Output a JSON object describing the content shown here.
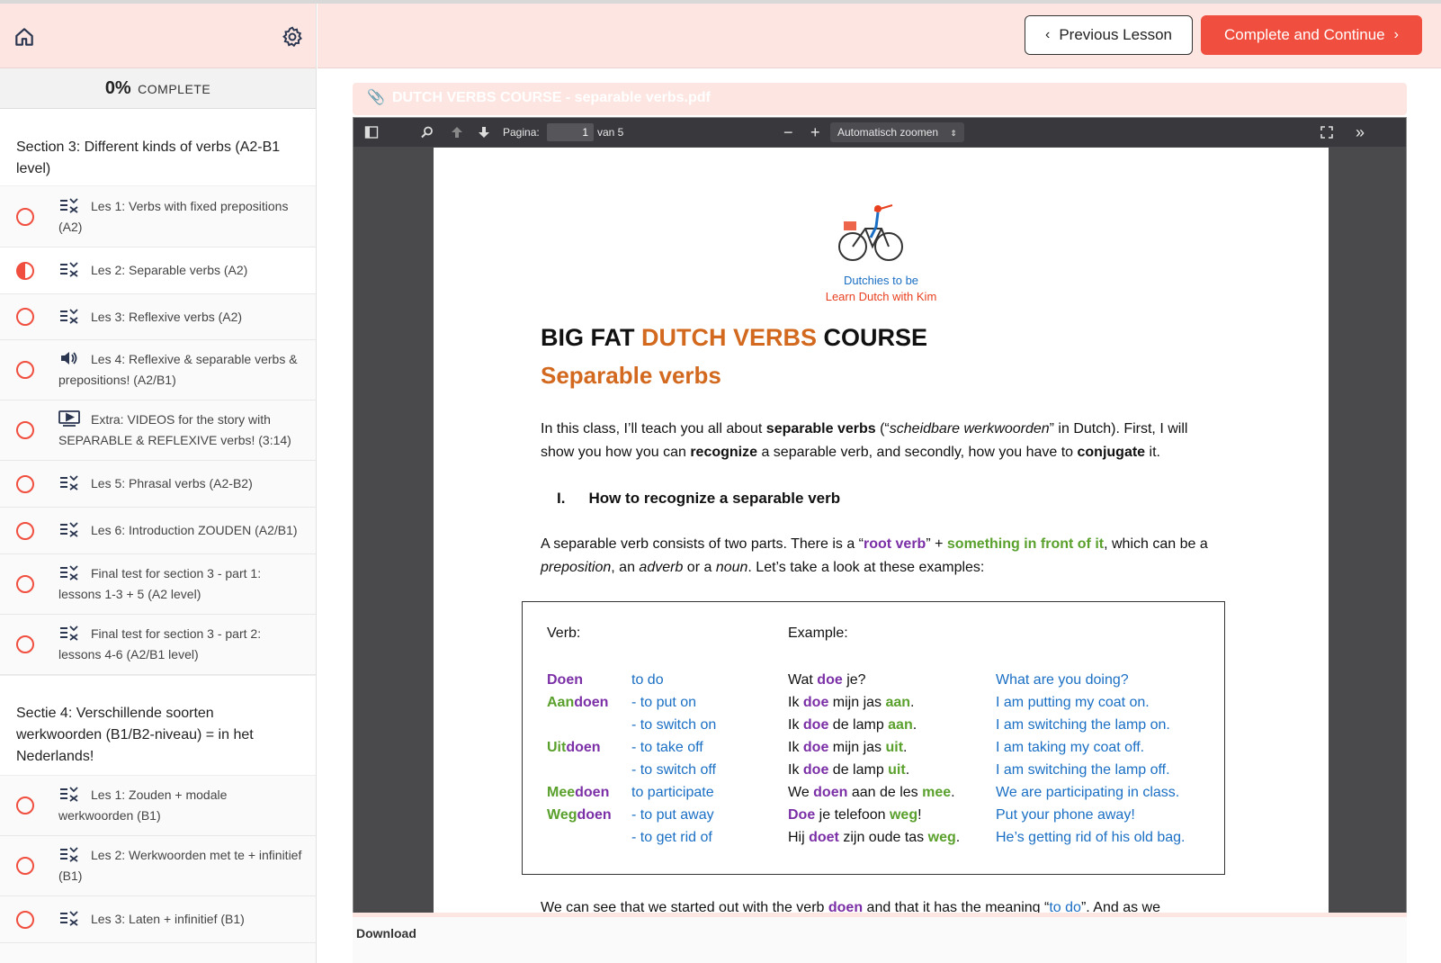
{
  "sidebar": {
    "progress": {
      "percent": "0%",
      "label": "COMPLETE"
    },
    "section3": {
      "title": "Section 3: Different kinds of verbs (A2-B1 level)",
      "lessons": [
        {
          "icon": "quiz-icon",
          "label": "Les 1: Verbs with fixed prepositions (A2)",
          "status": "not-started"
        },
        {
          "icon": "quiz-icon",
          "label": "Les 2: Separable verbs (A2)",
          "status": "in-progress"
        },
        {
          "icon": "quiz-icon",
          "label": "Les 3: Reflexive verbs (A2)",
          "status": "not-started"
        },
        {
          "icon": "audio-icon",
          "label": "Les 4: Reflexive & separable verbs & prepositions! (A2/B1)",
          "status": "not-started"
        },
        {
          "icon": "video-icon",
          "label": "Extra: VIDEOS for the story with SEPARABLE & REFLEXIVE verbs! (3:14)",
          "status": "not-started"
        },
        {
          "icon": "quiz-icon",
          "label": "Les 5: Phrasal verbs (A2-B2)",
          "status": "not-started"
        },
        {
          "icon": "quiz-icon",
          "label": "Les 6: Introduction ZOUDEN (A2/B1)",
          "status": "not-started"
        },
        {
          "icon": "quiz-icon",
          "label": "Final test for section 3 - part 1: lessons 1-3 + 5 (A2 level)",
          "status": "not-started"
        },
        {
          "icon": "quiz-icon",
          "label": "Final test for section 3 - part 2: lessons 4-6 (A2/B1 level)",
          "status": "not-started"
        }
      ]
    },
    "section4": {
      "title": "Sectie 4: Verschillende soorten werkwoorden (B1/B2-niveau) = in het Nederlands!",
      "lessons": [
        {
          "icon": "quiz-icon",
          "label": "Les 1: Zouden + modale werkwoorden (B1)",
          "status": "not-started"
        },
        {
          "icon": "quiz-icon",
          "label": "Les 2: Werkwoorden met te + infinitief (B1)",
          "status": "not-started"
        },
        {
          "icon": "quiz-icon",
          "label": "Les 3: Laten + infinitief (B1)",
          "status": "not-started"
        }
      ]
    }
  },
  "header": {
    "prev_label": "Previous Lesson",
    "next_label": "Complete and Continue",
    "accent": "#f04e3e",
    "header_bg": "#fde6e1"
  },
  "attachment": {
    "title": "DUTCH VERBS COURSE - separable verbs.pdf"
  },
  "viewer": {
    "page_label": "Pagina:",
    "page_value": "1",
    "page_total": "van 5",
    "zoom_label": "Automatisch zoomen"
  },
  "document": {
    "logo_line1": "Dutchies to be",
    "logo_line2": "Learn Dutch with Kim",
    "title_a": "BIG FAT ",
    "title_b": "DUTCH VERBS",
    "title_c": " COURSE",
    "subtitle": "Separable verbs",
    "intro": {
      "a": "In this class, I’ll teach you all about ",
      "b": "separable verbs",
      "c": " (“",
      "d": "scheidbare werkwoorden",
      "e": "” in Dutch). First, I will show you how you can ",
      "f": "recognize",
      "g": " a separable verb, and secondly, how you have to ",
      "h": "conjugate",
      "i": " it."
    },
    "heading_num": "I.",
    "heading": "How to recognize a separable verb",
    "para2": {
      "a": "A separable verb consists of two parts. There is a “",
      "b": "root verb",
      "c": "” + ",
      "d": "something in front of it",
      "e": ", which can be a ",
      "f": "preposition",
      "g": ", an ",
      "h": "adverb",
      "i": " or a ",
      "j": "noun",
      "k": ". Let’s take a look at these examples:"
    },
    "table": {
      "verb_header": "Verb:",
      "example_header": "Example:",
      "rows": [
        {
          "pre": "",
          "root": "Doen",
          "meaning": "to do",
          "ex_a": "Wat ",
          "ex_v": "doe",
          "ex_b": " je?",
          "ex_p": "",
          "ex_c": "",
          "translation": "What are you doing?"
        },
        {
          "pre": "Aan",
          "root": "doen",
          "meaning": "- to put on",
          "ex_a": "Ik ",
          "ex_v": "doe",
          "ex_b": " mijn jas ",
          "ex_p": "aan",
          "ex_c": ".",
          "translation": "I am putting my coat on."
        },
        {
          "pre": "",
          "root": "",
          "meaning": "- to switch on",
          "ex_a": "Ik ",
          "ex_v": "doe",
          "ex_b": " de lamp ",
          "ex_p": "aan",
          "ex_c": ".",
          "translation": "I am switching the lamp on."
        },
        {
          "pre": "Uit",
          "root": "doen",
          "meaning": "- to take off",
          "ex_a": "Ik ",
          "ex_v": "doe",
          "ex_b": " mijn jas ",
          "ex_p": "uit",
          "ex_c": ".",
          "translation": "I am taking my coat off."
        },
        {
          "pre": "",
          "root": "",
          "meaning": "- to switch off",
          "ex_a": "Ik ",
          "ex_v": "doe",
          "ex_b": " de lamp ",
          "ex_p": "uit",
          "ex_c": ".",
          "translation": "I am switching the lamp off."
        },
        {
          "pre": "Mee",
          "root": "doen",
          "meaning": "to participate",
          "ex_a": "We ",
          "ex_v": "doen",
          "ex_b": " aan de les ",
          "ex_p": "mee",
          "ex_c": ".",
          "translation": "We are participating in class."
        },
        {
          "pre": "Weg",
          "root": "doen",
          "meaning": "- to put away",
          "ex_a": "",
          "ex_v": "Doe",
          "ex_b": " je telefoon ",
          "ex_p": "weg",
          "ex_c": "!",
          "translation": "Put your phone away!"
        },
        {
          "pre": "",
          "root": "",
          "meaning": "- to get rid of",
          "ex_a": "Hij ",
          "ex_v": "doet",
          "ex_b": " zijn oude tas ",
          "ex_p": "weg",
          "ex_c": ".",
          "translation": "He’s getting rid of his old bag."
        }
      ]
    },
    "cut_line": {
      "a": "We can see that we started out with the verb ",
      "b": "doen",
      "c": " and that it has the meaning “",
      "d": "to do",
      "e": "”. And as we"
    }
  },
  "download_label": "Download"
}
